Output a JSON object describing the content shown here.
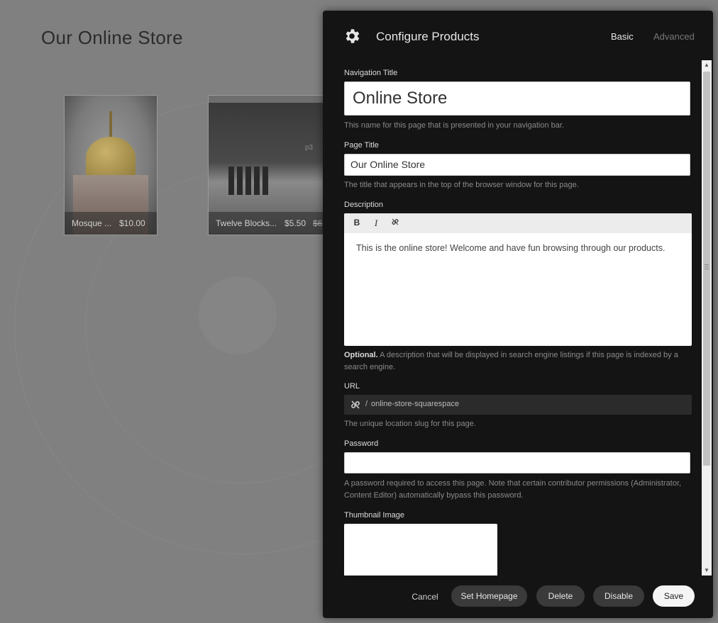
{
  "page": {
    "title": "Our Online Store",
    "products": [
      {
        "name": "Mosque ...",
        "price": "$10.00"
      },
      {
        "name": "Twelve Blocks...",
        "price": "$5.50",
        "old_price": "$6",
        "image_label": "p3"
      }
    ]
  },
  "panel": {
    "title": "Configure Products",
    "icon": "gear-icon",
    "tabs": {
      "basic": "Basic",
      "advanced": "Advanced"
    },
    "fields": {
      "nav_title": {
        "label": "Navigation Title",
        "value": "Online Store",
        "help": "This name for this page that is presented in your navigation bar."
      },
      "page_title": {
        "label": "Page Title",
        "value": "Our Online Store",
        "help": "The title that appears in the top of the browser window for this page."
      },
      "description": {
        "label": "Description",
        "toolbar": {
          "bold": "B",
          "italic": "I"
        },
        "value": "This is the online store! Welcome and have fun browsing through our products.",
        "help_strong": "Optional.",
        "help": " A description that will be displayed in search engine listings if this page is indexed by a search engine."
      },
      "url": {
        "label": "URL",
        "separator": "/",
        "value": "online-store-squarespace",
        "help": "The unique location slug for this page."
      },
      "password": {
        "label": "Password",
        "value": "",
        "help": "A password required to access this page. Note that certain contributor permissions (Administrator, Content Editor) automatically bypass this password."
      },
      "thumbnail": {
        "label": "Thumbnail Image"
      }
    },
    "buttons": {
      "cancel": "Cancel",
      "set_homepage": "Set Homepage",
      "delete": "Delete",
      "disable": "Disable",
      "save": "Save"
    }
  }
}
